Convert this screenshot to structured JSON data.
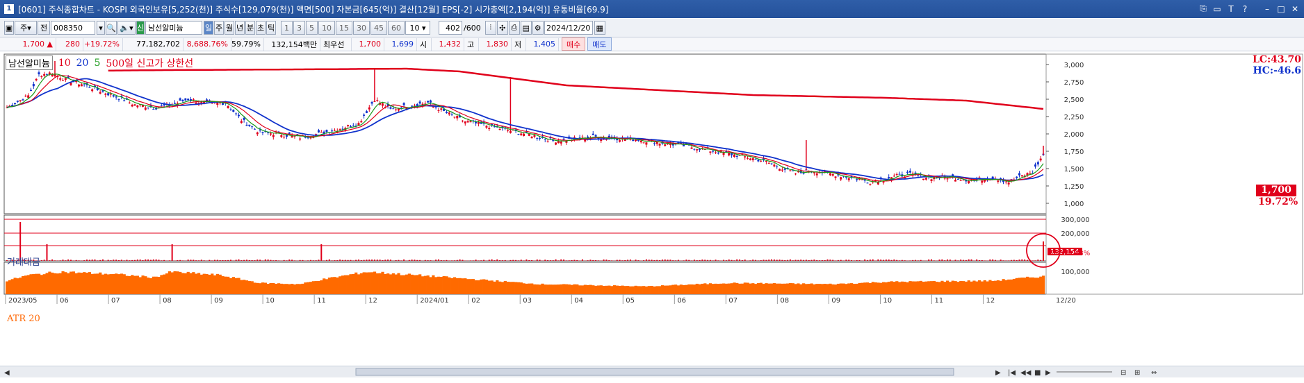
{
  "window": {
    "app_icon": "1",
    "title": "[0601] 주식종합차트 - KOSPI 외국인보유[5,252(천)] 주식수[129,079(천)] 액면[500] 자본금[645(억)] 결산[12월] EPS[-2] 시가총액[2,194(억)] 유통비율[69.9]"
  },
  "toolbar": {
    "market": "주",
    "prev_label": "전",
    "code": "008350",
    "new_badge": "신",
    "stock_name": "남선알미늄",
    "periods": [
      "일",
      "주",
      "월",
      "년",
      "분",
      "초",
      "틱"
    ],
    "active_period": "일",
    "intervals": [
      "1",
      "3",
      "5",
      "10",
      "15",
      "30",
      "45",
      "60"
    ],
    "interval_select": "10",
    "count": "402",
    "count_total": "/600",
    "date": "2024/12/20"
  },
  "quote": {
    "price": "1,700",
    "change": "280",
    "change_pct": "+19.72%",
    "volume": "77,182,702",
    "volume_ratio": "8,688.76%",
    "turnover": "59.79%",
    "amount": "132,154백만",
    "best_label": "최우선",
    "best_ask": "1,700",
    "best_bid": "1,699",
    "open_label": "시",
    "open": "1,432",
    "high_label": "고",
    "high": "1,830",
    "low_label": "저",
    "low": "1,405",
    "buy_label": "매수",
    "sell_label": "매도"
  },
  "legend": {
    "name": "남선알미늄",
    "ma1": "10",
    "ma2": "20",
    "ma3": "5",
    "high_line": "500일 신고가 상한선"
  },
  "right_labels": {
    "lc": "LC:43.70",
    "hc": "HC:-46.6",
    "current_price": "1,700",
    "current_pct": "19.72%",
    "volume_value": "132,154",
    "volume_pct": "22590.43%"
  },
  "volume_pane": {
    "title": "거래대금"
  },
  "atr_pane": {
    "title": "ATR 20"
  },
  "chart_data": {
    "type": "candlestick",
    "price_axis": {
      "ticks": [
        "3,000",
        "2,750",
        "2,500",
        "2,250",
        "2,000",
        "1,750",
        "1,500",
        "1,250",
        "1,000"
      ],
      "values": [
        3000,
        2750,
        2500,
        2250,
        2000,
        1750,
        1500,
        1250,
        1000
      ]
    },
    "volume_axis": {
      "ticks": [
        "300,000",
        "200,000"
      ],
      "values": [
        300000,
        200000
      ]
    },
    "atr_axis": {
      "ticks": [
        "100,000"
      ],
      "values": [
        100000
      ]
    },
    "x_ticks": [
      "2023/05",
      "06",
      "07",
      "08",
      "09",
      "10",
      "11",
      "12",
      "2024/01",
      "02",
      "03",
      "04",
      "05",
      "06",
      "07",
      "08",
      "09",
      "10",
      "11",
      "12"
    ],
    "x_last": "12/20",
    "series": [
      {
        "name": "10",
        "color": "#e0001b"
      },
      {
        "name": "20",
        "color": "#1133cc"
      },
      {
        "name": "5",
        "color": "#1a9a1a"
      },
      {
        "name": "500일 신고가 상한선",
        "color": "#e0001b"
      }
    ],
    "close_path": [
      [
        0,
        2380
      ],
      [
        8,
        2550
      ],
      [
        12,
        2850
      ],
      [
        17,
        2880
      ],
      [
        22,
        2780
      ],
      [
        28,
        2720
      ],
      [
        35,
        2620
      ],
      [
        42,
        2520
      ],
      [
        48,
        2420
      ],
      [
        56,
        2380
      ],
      [
        62,
        2420
      ],
      [
        68,
        2500
      ],
      [
        75,
        2440
      ],
      [
        82,
        2450
      ],
      [
        88,
        2200
      ],
      [
        95,
        2020
      ],
      [
        102,
        2000
      ],
      [
        110,
        1950
      ],
      [
        118,
        2010
      ],
      [
        125,
        2080
      ],
      [
        132,
        2150
      ],
      [
        138,
        2500
      ],
      [
        144,
        2350
      ],
      [
        150,
        2400
      ],
      [
        158,
        2450
      ],
      [
        165,
        2300
      ],
      [
        172,
        2180
      ],
      [
        180,
        2120
      ],
      [
        188,
        2050
      ],
      [
        196,
        1990
      ],
      [
        205,
        1900
      ],
      [
        212,
        1920
      ],
      [
        220,
        1960
      ],
      [
        228,
        1940
      ],
      [
        236,
        1920
      ],
      [
        244,
        1880
      ],
      [
        252,
        1840
      ],
      [
        260,
        1790
      ],
      [
        268,
        1730
      ],
      [
        276,
        1680
      ],
      [
        284,
        1610
      ],
      [
        290,
        1520
      ],
      [
        296,
        1430
      ],
      [
        302,
        1470
      ],
      [
        310,
        1420
      ],
      [
        318,
        1360
      ],
      [
        324,
        1310
      ],
      [
        332,
        1380
      ],
      [
        338,
        1420
      ],
      [
        346,
        1370
      ],
      [
        354,
        1380
      ],
      [
        362,
        1330
      ],
      [
        370,
        1370
      ],
      [
        376,
        1310
      ],
      [
        380,
        1380
      ],
      [
        385,
        1450
      ],
      [
        389,
        1700
      ]
    ],
    "high_line_path": [
      [
        0,
        2900
      ],
      [
        60,
        2920
      ],
      [
        110,
        2930
      ],
      [
        150,
        2940
      ],
      [
        170,
        2900
      ],
      [
        190,
        2800
      ],
      [
        210,
        2700
      ],
      [
        250,
        2620
      ],
      [
        280,
        2560
      ],
      [
        330,
        2520
      ],
      [
        360,
        2480
      ],
      [
        389,
        2360
      ]
    ],
    "volume_spikes": [
      [
        5,
        280000
      ],
      [
        15,
        120000
      ],
      [
        62,
        120000
      ],
      [
        118,
        120000
      ],
      [
        389,
        140000
      ]
    ],
    "atr_profile": [
      [
        0,
        60000
      ],
      [
        8,
        85000
      ],
      [
        20,
        100000
      ],
      [
        40,
        90000
      ],
      [
        55,
        75000
      ],
      [
        62,
        100000
      ],
      [
        80,
        85000
      ],
      [
        95,
        50000
      ],
      [
        110,
        45000
      ],
      [
        118,
        65000
      ],
      [
        135,
        100000
      ],
      [
        160,
        80000
      ],
      [
        200,
        45000
      ],
      [
        240,
        35000
      ],
      [
        270,
        50000
      ],
      [
        310,
        45000
      ],
      [
        330,
        55000
      ],
      [
        370,
        60000
      ],
      [
        389,
        80000
      ]
    ]
  }
}
